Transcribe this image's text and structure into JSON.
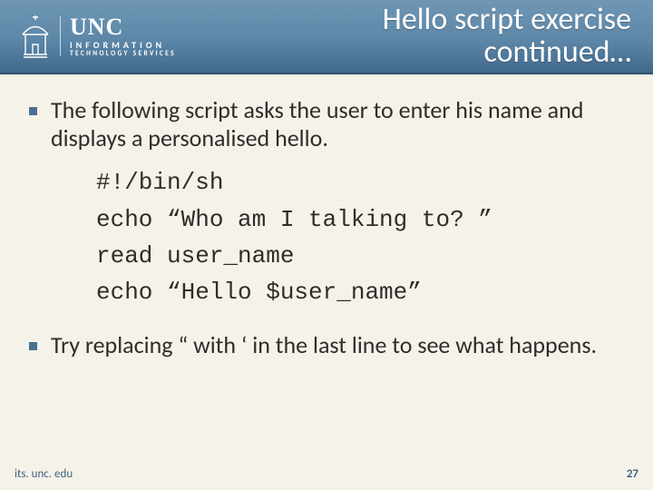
{
  "header": {
    "logo": {
      "name": "UNC",
      "sub1": "INFORMATION",
      "sub2": "TECHNOLOGY SERVICES"
    },
    "title_line1": "Hello script exercise",
    "title_line2": "continued…"
  },
  "bullets": [
    "The following script asks the user to enter his name and displays a personalised hello.",
    "Try replacing “ with ‘ in the last line to see what happens."
  ],
  "code": {
    "lines": [
      "#!/bin/sh",
      "echo “Who am I talking to? ”",
      "read user_name",
      "echo “Hello $user_name”"
    ]
  },
  "footer": {
    "url": "its. unc. edu",
    "page": "27"
  }
}
